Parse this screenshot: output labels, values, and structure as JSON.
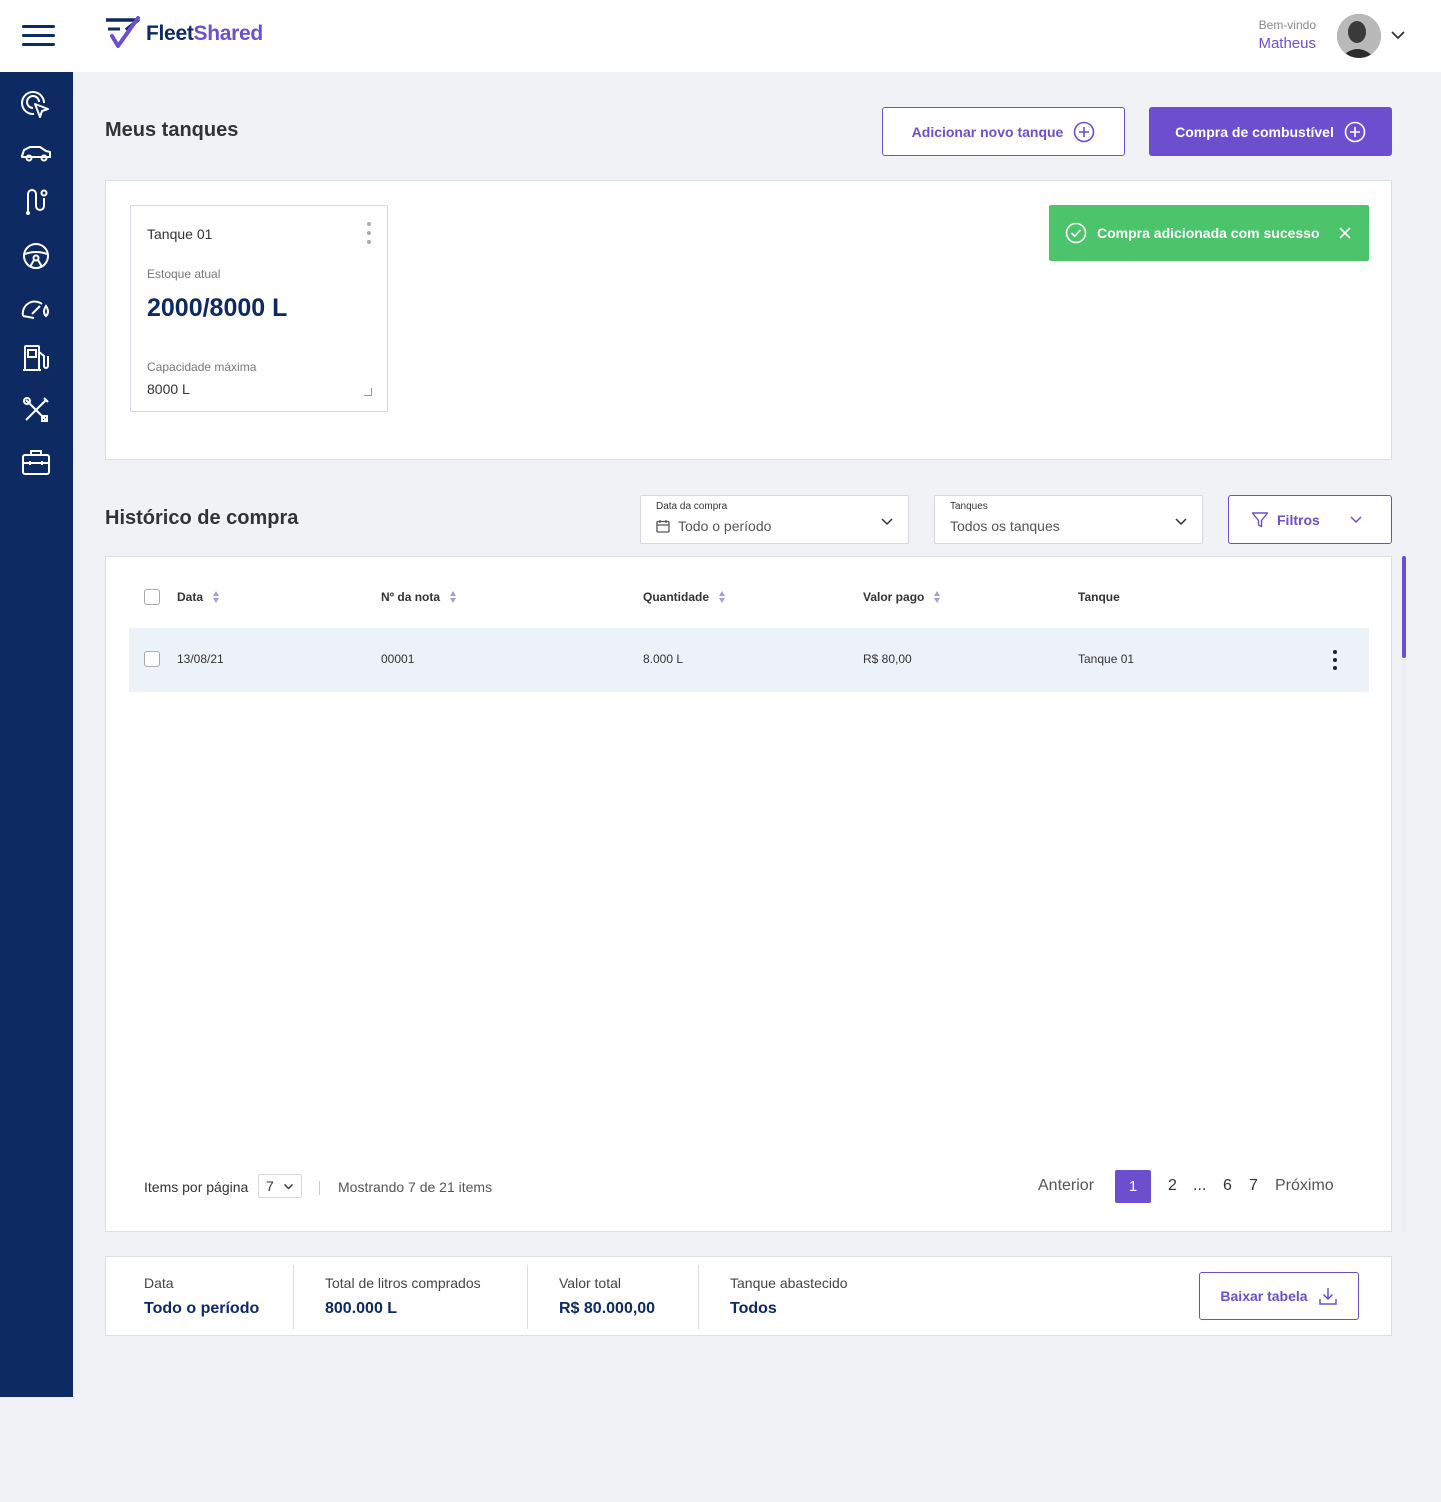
{
  "header": {
    "logo_fleet": "Fleet",
    "logo_shared": "Shared",
    "welcome": "Bem-vindo",
    "user_name": "Matheus"
  },
  "sidebar": {
    "items": [
      {
        "icon": "dashboard-pointer-icon"
      },
      {
        "icon": "car-icon"
      },
      {
        "icon": "route-icon"
      },
      {
        "icon": "steering-wheel-icon"
      },
      {
        "icon": "speedometer-fuel-icon"
      },
      {
        "icon": "fuel-pump-icon"
      },
      {
        "icon": "tools-icon"
      },
      {
        "icon": "briefcase-icon"
      }
    ]
  },
  "page": {
    "title": "Meus tanques",
    "add_tank_label": "Adicionar novo tanque",
    "buy_fuel_label": "Compra de combustível"
  },
  "tank_card": {
    "name": "Tanque 01",
    "stock_label": "Estoque atual",
    "stock_value": "2000/8000 L",
    "capacity_label": "Capacidade máxima",
    "capacity_value": "8000 L"
  },
  "toast": {
    "message": "Compra adicionada com sucesso",
    "color": "#4cc46b"
  },
  "history": {
    "title": "Histórico de compra",
    "date_filter": {
      "label": "Data da compra",
      "value": "Todo o período"
    },
    "tank_filter": {
      "label": "Tanques",
      "value": "Todos os tanques"
    },
    "filters_label": "Filtros"
  },
  "table": {
    "columns": [
      "Data",
      "Nº da nota",
      "Quantidade",
      "Valor pago",
      "Tanque"
    ],
    "rows": [
      {
        "data": "13/08/21",
        "nota": "00001",
        "quantidade": "8.000 L",
        "valor": "R$ 80,00",
        "tanque": "Tanque 01"
      }
    ]
  },
  "pagination": {
    "items_per_page_label": "Items por página",
    "items_per_page_value": "7",
    "showing": "Mostrando 7 de 21 items",
    "prev": "Anterior",
    "pages": [
      "1",
      "2",
      "...",
      "6",
      "7"
    ],
    "active_page": "1",
    "next": "Próximo"
  },
  "summary": {
    "date_label": "Data",
    "date_value": "Todo o período",
    "liters_label": "Total de litros comprados",
    "liters_value": "800.000 L",
    "total_label": "Valor total",
    "total_value": "R$ 80.000,00",
    "tank_label": "Tanque abastecido",
    "tank_value": "Todos",
    "download_label": "Baixar tabela"
  },
  "colors": {
    "navy": "#0d2a63",
    "purple": "#6c4fce",
    "success": "#4cc46b",
    "background": "#f1f2f6"
  }
}
